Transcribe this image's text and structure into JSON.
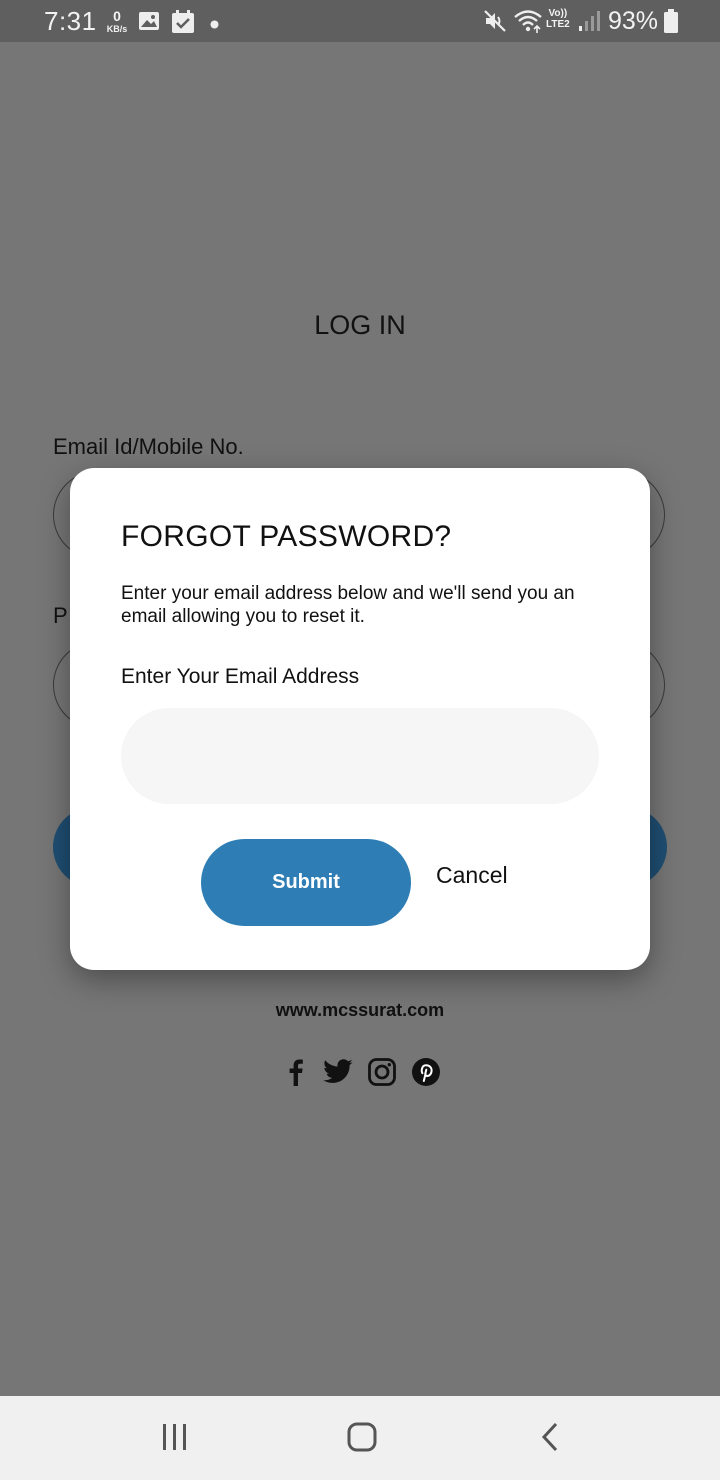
{
  "status_bar": {
    "time": "7:31",
    "net_speed_value": "0",
    "net_speed_unit": "KB/s",
    "lte_top": "Vo))",
    "lte_bottom": "LTE2",
    "battery": "93%",
    "icons": [
      "image-icon",
      "calendar-icon",
      "dot-icon",
      "mute-icon",
      "wifi-icon",
      "signal-icon",
      "battery-icon"
    ]
  },
  "login": {
    "title": "LOG IN",
    "email_label": "Email Id/Mobile No.",
    "password_label_partial": "P",
    "website": "www.mcssurat.com",
    "social_icons": [
      "facebook-icon",
      "twitter-icon",
      "instagram-icon",
      "pinterest-icon"
    ]
  },
  "dialog": {
    "title": "FORGOT PASSWORD?",
    "description": "Enter your email address below and we'll send you an email allowing you to reset it.",
    "email_label": "Enter Your Email Address",
    "email_value": "",
    "email_placeholder": "",
    "submit_label": "Submit",
    "cancel_label": "Cancel"
  },
  "colors": {
    "primary": "#2e7eb5",
    "overlay": "#767676",
    "input_fill": "#f6f6f6"
  },
  "nav_bar": {
    "icons": [
      "recent-apps-icon",
      "home-icon",
      "back-icon"
    ]
  }
}
